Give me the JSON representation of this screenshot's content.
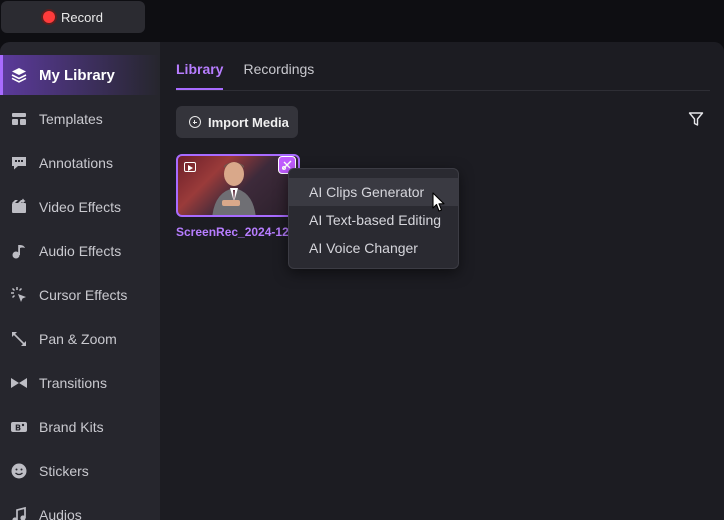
{
  "topbar": {
    "record_label": "Record"
  },
  "sidebar": {
    "items": [
      {
        "label": "My Library",
        "icon": "layers-icon",
        "active": true
      },
      {
        "label": "Templates",
        "icon": "template-icon"
      },
      {
        "label": "Annotations",
        "icon": "annotation-icon"
      },
      {
        "label": "Video Effects",
        "icon": "video-effects-icon"
      },
      {
        "label": "Audio Effects",
        "icon": "music-note-icon"
      },
      {
        "label": "Cursor Effects",
        "icon": "cursor-click-icon"
      },
      {
        "label": "Pan & Zoom",
        "icon": "pan-zoom-icon"
      },
      {
        "label": "Transitions",
        "icon": "transition-icon"
      },
      {
        "label": "Brand Kits",
        "icon": "brand-kit-icon"
      },
      {
        "label": "Stickers",
        "icon": "sticker-icon"
      },
      {
        "label": "Audios",
        "icon": "audio-icon"
      }
    ]
  },
  "main": {
    "tabs": [
      {
        "label": "Library",
        "active": true
      },
      {
        "label": "Recordings",
        "active": false
      }
    ],
    "import_label": "Import Media",
    "media": [
      {
        "name": "ScreenRec_2024-12"
      }
    ]
  },
  "context_menu": {
    "items": [
      {
        "label": "AI Clips Generator",
        "hover": true
      },
      {
        "label": "AI Text-based Editing"
      },
      {
        "label": "AI Voice Changer"
      }
    ]
  },
  "colors": {
    "accent": "#a86bff",
    "record_dot": "#ff3b3b",
    "ai_badge": "#c15cff"
  }
}
